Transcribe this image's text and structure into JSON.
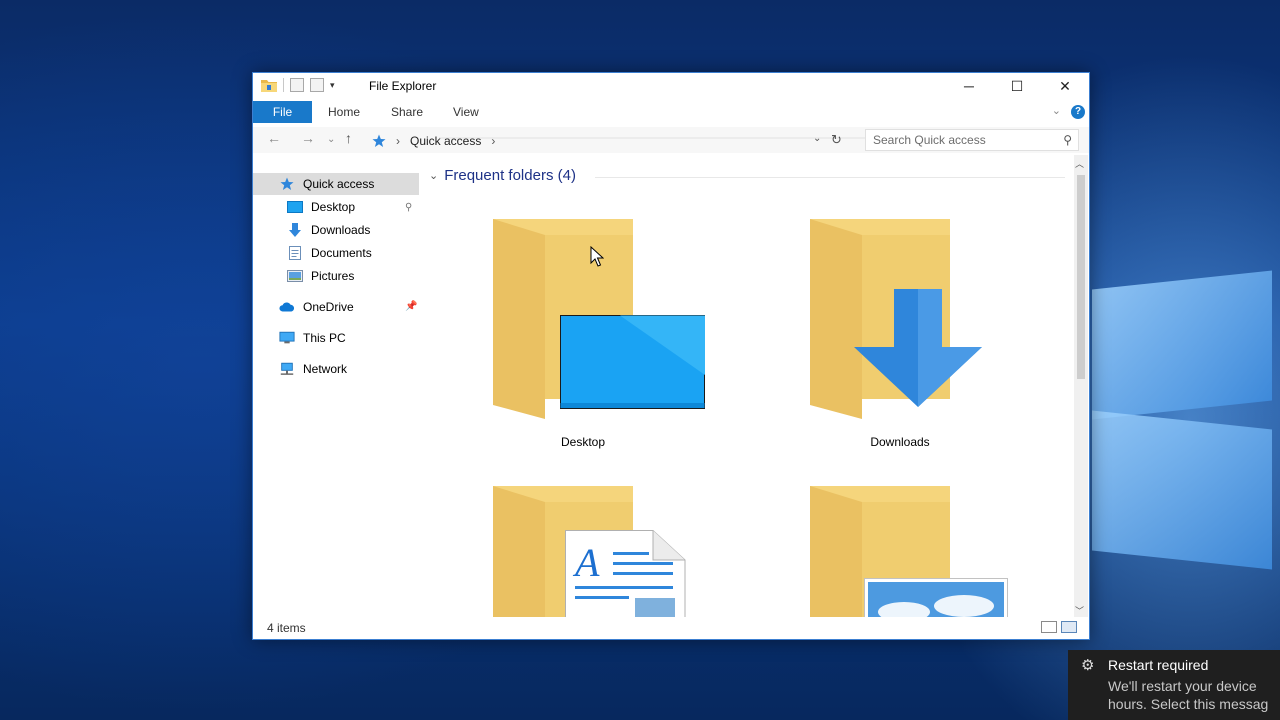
{
  "window": {
    "title": "File Explorer",
    "controls": {
      "minimize": "─",
      "maximize": "☐",
      "close": "✕"
    }
  },
  "ribbon": {
    "tabs": [
      "File",
      "Home",
      "Share",
      "View"
    ],
    "help": "?"
  },
  "address": {
    "crumb_separator": "›",
    "location": "Quick access",
    "search_placeholder": "Search Quick access"
  },
  "nav_pane": {
    "quick_access": "Quick access",
    "pinned": [
      "Desktop",
      "Downloads",
      "Documents",
      "Pictures"
    ],
    "onedrive": "OneDrive",
    "this_pc": "This PC",
    "network": "Network"
  },
  "content": {
    "group_title": "Frequent folders (4)",
    "folders": [
      {
        "name": "Desktop",
        "overlay": "desktop"
      },
      {
        "name": "Downloads",
        "overlay": "downloads"
      },
      {
        "name": "",
        "overlay": "documents"
      },
      {
        "name": "",
        "overlay": "pictures"
      }
    ]
  },
  "status_bar": {
    "items": "4 items"
  },
  "toast": {
    "title": "Restart required",
    "body": "We'll restart your device\nhours. Select this messag"
  },
  "colors": {
    "accent": "#1979ca",
    "folder": "#f5d57c",
    "group_title": "#1e3287"
  },
  "icons": [
    "folder-icon",
    "pin-icon",
    "quick-access-star-icon",
    "desktop-icon",
    "download-arrow-icon",
    "documents-icon",
    "pictures-icon",
    "onedrive-cloud-icon",
    "this-pc-icon",
    "network-icon",
    "search-icon",
    "refresh-icon",
    "gear-icon"
  ]
}
